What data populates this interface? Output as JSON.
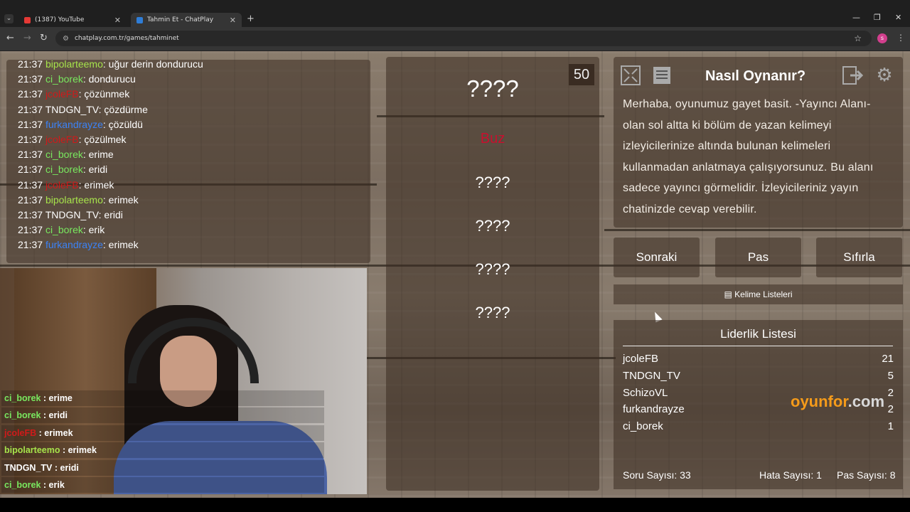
{
  "browser": {
    "tabs": [
      {
        "title": "(1387) YouTube",
        "favicon_color": "#e53935",
        "active": false
      },
      {
        "title": "Tahmin Et - ChatPlay",
        "favicon_color": "#2e7dd7",
        "active": true
      }
    ],
    "url": "chatplay.com.tr/games/tahminet",
    "profile_initial": "s"
  },
  "chat_log": [
    {
      "time": "21:37",
      "user": "bipolarteemo",
      "color": "#a6e34b",
      "msg": "uğur derin dondurucu"
    },
    {
      "time": "21:37",
      "user": "ci_borek",
      "color": "#79e85f",
      "msg": "dondurucu"
    },
    {
      "time": "21:37",
      "user": "jcoleFB",
      "color": "#d01a1a",
      "msg": "çözünmek"
    },
    {
      "time": "21:37",
      "user": "TNDGN_TV",
      "color": "#ffffff",
      "msg": "çözdürme"
    },
    {
      "time": "21:37",
      "user": "furkandrayze",
      "color": "#3b82f6",
      "msg": "çözüldü"
    },
    {
      "time": "21:37",
      "user": "jcoleFB",
      "color": "#d01a1a",
      "msg": "çözülmek"
    },
    {
      "time": "21:37",
      "user": "ci_borek",
      "color": "#79e85f",
      "msg": "erime"
    },
    {
      "time": "21:37",
      "user": "ci_borek",
      "color": "#79e85f",
      "msg": "eridi"
    },
    {
      "time": "21:37",
      "user": "jcoleFB",
      "color": "#d01a1a",
      "msg": "erimek"
    },
    {
      "time": "21:37",
      "user": "bipolarteemo",
      "color": "#a6e34b",
      "msg": "erimek"
    },
    {
      "time": "21:37",
      "user": "TNDGN_TV",
      "color": "#ffffff",
      "msg": "eridi"
    },
    {
      "time": "21:37",
      "user": "ci_borek",
      "color": "#79e85f",
      "msg": "erik"
    },
    {
      "time": "21:37",
      "user": "furkandrayze",
      "color": "#3b82f6",
      "msg": "erimek"
    }
  ],
  "cam_chat": [
    {
      "user": "ci_borek",
      "color": "#79e85f",
      "msg": "erime"
    },
    {
      "user": "ci_borek",
      "color": "#79e85f",
      "msg": "eridi"
    },
    {
      "user": "jcoleFB",
      "color": "#d01a1a",
      "msg": "erimek"
    },
    {
      "user": "bipolarteemo",
      "color": "#a6e34b",
      "msg": "erimek"
    },
    {
      "user": "TNDGN_TV",
      "color": "#ffffff",
      "msg": "eridi"
    },
    {
      "user": "ci_borek",
      "color": "#79e85f",
      "msg": "erik"
    }
  ],
  "game": {
    "score": "50",
    "secret_word": "????",
    "answer_word": "Buz",
    "answer_color": "#c8102e",
    "forbidden": [
      "????",
      "????",
      "????",
      "????"
    ],
    "how_to_title": "Nasıl Oynanır?",
    "instructions": "Merhaba, oyunumuz gayet basit. -Yayıncı Alanı- olan sol altta ki bölüm de yazan kelimeyi izleyicilerinize altında bulunan kelimeleri kullanmadan anlatmaya çalışıyorsunuz. Bu alanı sadece yayıncı görmelidir. İzleyicileriniz yayın chatinizde cevap verebilir.",
    "buttons": {
      "next": "Sonraki",
      "pass": "Pas",
      "reset": "Sıfırla"
    },
    "word_lists": "Kelime Listeleri",
    "icons": {
      "fullscreen": "fullscreen-icon",
      "list": "document-icon",
      "exit": "exit-icon",
      "settings": "gear-icon"
    }
  },
  "leaderboard": {
    "title": "Liderlik Listesi",
    "rows": [
      {
        "name": "jcoleFB",
        "points": "21"
      },
      {
        "name": "TNDGN_TV",
        "points": "5"
      },
      {
        "name": "SchizoVL",
        "points": "2"
      },
      {
        "name": "furkandrayze",
        "points": "2"
      },
      {
        "name": "ci_borek",
        "points": "1"
      }
    ]
  },
  "stats": {
    "questions": "Soru Sayısı: 33",
    "errors": "Hata Sayısı: 1",
    "passes": "Pas Sayısı: 8"
  },
  "watermark": {
    "brand": "oyunfor",
    "tld": ".com"
  }
}
